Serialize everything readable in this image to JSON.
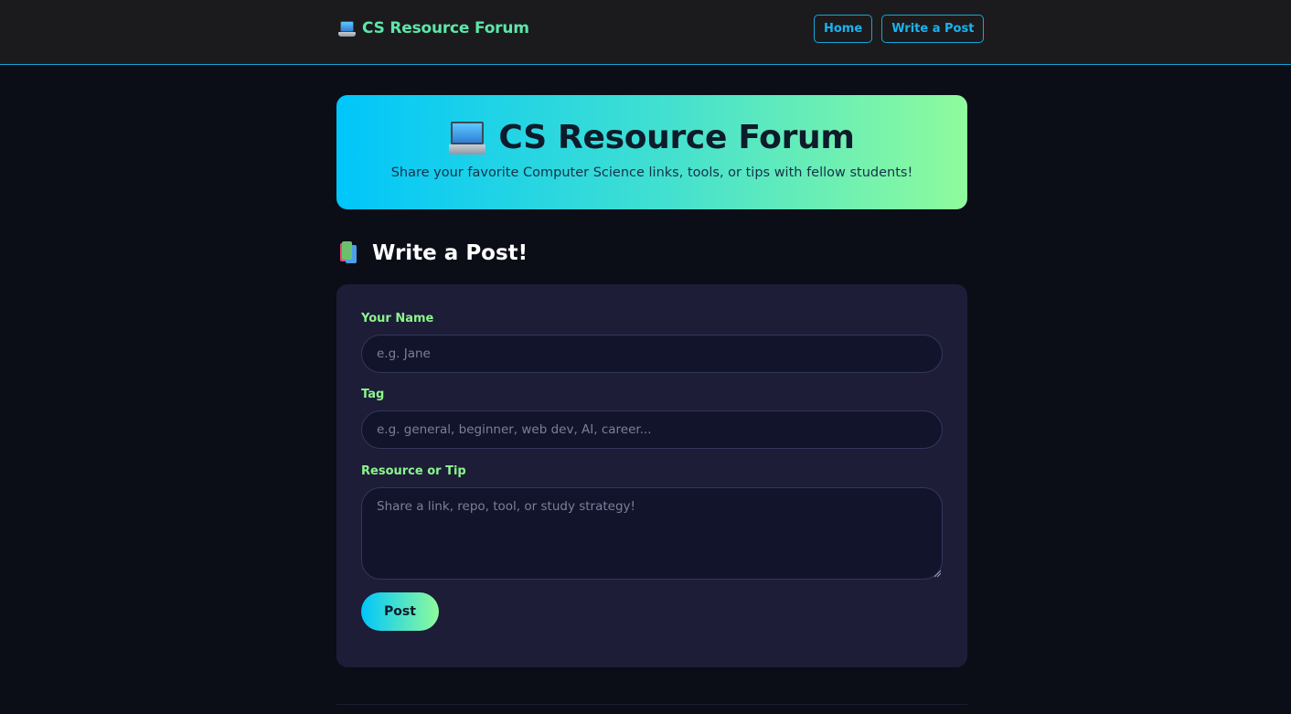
{
  "navbar": {
    "brand_icon": "laptop-icon",
    "brand_text": "CS Resource Forum",
    "links": [
      {
        "label": "Home"
      },
      {
        "label": "Write a Post"
      }
    ]
  },
  "hero": {
    "icon": "laptop-icon",
    "title": "CS Resource Forum",
    "subtitle": "Share your favorite Computer Science links, tools, or tips with fellow students!"
  },
  "section": {
    "icon": "books-icon",
    "heading": "Write a Post!"
  },
  "form": {
    "name_label": "Your Name",
    "name_placeholder": "e.g. Jane",
    "tag_label": "Tag",
    "tag_placeholder": "e.g. general, beginner, web dev, AI, career...",
    "resource_label": "Resource or Tip",
    "resource_placeholder": "Share a link, repo, tool, or study strategy!",
    "submit_label": "Post"
  },
  "colors": {
    "accent_blue": "#16a5d8",
    "accent_green": "#8cf58c",
    "gradient_start": "#00c6fb",
    "gradient_end": "#8ffb9c",
    "background": "#0b0d17",
    "card": "#1d1d38"
  }
}
